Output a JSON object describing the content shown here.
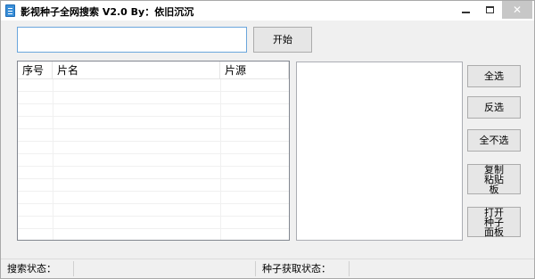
{
  "window": {
    "title": "影视种子全网搜索 V2.0 By：依旧沉沉"
  },
  "search": {
    "value": "",
    "start_label": "开始"
  },
  "list": {
    "columns": [
      "序号",
      "片名",
      "片源"
    ],
    "rows": []
  },
  "buttons": {
    "select_all": "全选",
    "invert": "反选",
    "select_none": "全不选",
    "copy_clipboard": "复制粘贴板",
    "open_panel": "打开种子面板"
  },
  "status": {
    "search_label": "搜索状态：",
    "search_value": "",
    "seed_label": "种子获取状态：",
    "seed_value": ""
  }
}
